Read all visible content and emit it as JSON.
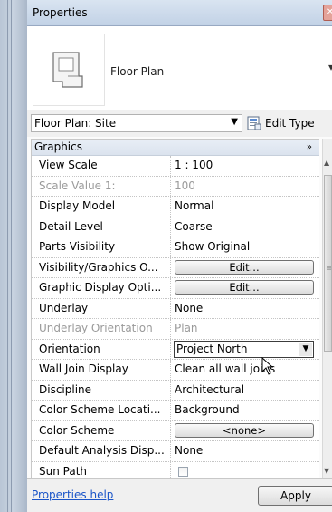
{
  "window": {
    "title": "Properties"
  },
  "type_selector": {
    "type_name": "Floor Plan"
  },
  "instance_selector": {
    "value": "Floor Plan: Site",
    "edit_type_label": "Edit Type"
  },
  "group": {
    "label": "Graphics",
    "chevron": "»"
  },
  "rows": [
    {
      "name": "View Scale",
      "value": "1 : 100",
      "kind": "text"
    },
    {
      "name": "Scale Value 1:",
      "value": "100",
      "kind": "text",
      "disabled": true
    },
    {
      "name": "Display Model",
      "value": "Normal",
      "kind": "text"
    },
    {
      "name": "Detail Level",
      "value": "Coarse",
      "kind": "text"
    },
    {
      "name": "Parts Visibility",
      "value": "Show Original",
      "kind": "text"
    },
    {
      "name": "Visibility/Graphics O...",
      "value": "Edit...",
      "kind": "button"
    },
    {
      "name": "Graphic Display Opti...",
      "value": "Edit...",
      "kind": "button"
    },
    {
      "name": "Underlay",
      "value": "None",
      "kind": "text"
    },
    {
      "name": "Underlay Orientation",
      "value": "Plan",
      "kind": "text",
      "disabled": true
    },
    {
      "name": "Orientation",
      "value": "Project North",
      "kind": "combo"
    },
    {
      "name": "Wall Join Display",
      "value": "Clean all wall joins",
      "kind": "text"
    },
    {
      "name": "Discipline",
      "value": "Architectural",
      "kind": "text"
    },
    {
      "name": "Color Scheme Locati...",
      "value": "Background",
      "kind": "text"
    },
    {
      "name": "Color Scheme",
      "value": "<none>",
      "kind": "button"
    },
    {
      "name": "Default Analysis Disp...",
      "value": "None",
      "kind": "text"
    },
    {
      "name": "Sun Path",
      "value": "",
      "kind": "checkbox"
    }
  ],
  "footer": {
    "help_label": "Properties help",
    "apply_label": "Apply"
  },
  "colors": {
    "link": "#1a55c8",
    "title_gradient_top": "#d9e4f1",
    "title_gradient_bottom": "#c2d2e6"
  }
}
